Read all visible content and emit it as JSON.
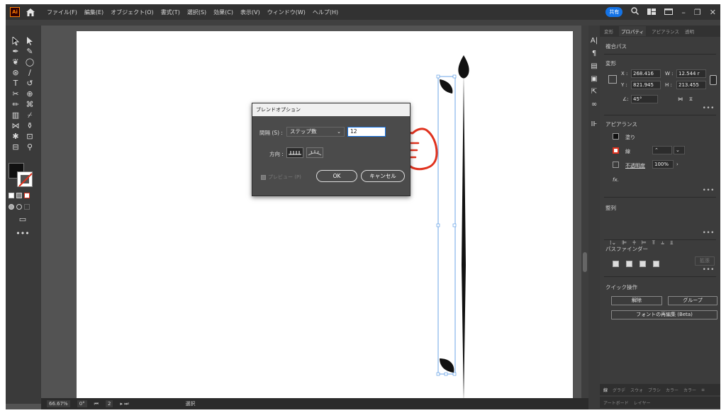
{
  "menubar": {
    "app_badge": "Ai",
    "menus": [
      "ファイル(F)",
      "編集(E)",
      "オブジェクト(O)",
      "書式(T)",
      "選択(S)",
      "効果(C)",
      "表示(V)",
      "ウィンドウ(W)",
      "ヘルプ(H)"
    ],
    "share_label": "共有"
  },
  "statusbar": {
    "zoom": "66.67%",
    "rotation": "0°",
    "artboard_index": "2",
    "mode": "選択"
  },
  "dialog": {
    "title": "ブレンドオプション",
    "spacing_label": "間隔 (S) :",
    "spacing_mode": "ステップ数",
    "steps_value": "12",
    "orientation_label": "方向 :",
    "preview_label": "プレビュー (P)",
    "ok_label": "OK",
    "cancel_label": "キャンセル"
  },
  "panel": {
    "tabs": [
      "変形",
      "プロパティ",
      "アピアランス",
      "透明"
    ],
    "active_tab": "プロパティ",
    "object_type": "複合パス",
    "transform_title": "変形",
    "x_label": "X :",
    "x_value": "268.416",
    "w_label": "W :",
    "w_value": "12.544 r",
    "y_label": "Y :",
    "y_value": "821.945",
    "h_label": "H :",
    "h_value": "213.455",
    "angle_value": "45°",
    "appearance_title": "アピアランス",
    "fill_label": "塗り",
    "stroke_label": "線",
    "opacity_label": "不透明度",
    "opacity_value": "100%",
    "fx_label": "fx.",
    "align_title": "整列",
    "pathfinder_title": "パスファインダー",
    "expand_label": "拡張",
    "quick_actions_title": "クイック操作",
    "release_label": "解除",
    "group_label": "グループ",
    "font_rebuild_label": "フォントの再編集 (Beta)",
    "bottom_tabs_1": [
      "線",
      "グラデ",
      "スウォ",
      "ブラシ",
      "カラー",
      "カラー"
    ],
    "bottom_tabs_2": [
      "アートボード",
      "レイヤー"
    ]
  },
  "colors": {
    "accent": "#1473e6",
    "hand_outline": "#e0321e",
    "chrome_dark": "#323232",
    "canvas_bg": "#535353"
  }
}
